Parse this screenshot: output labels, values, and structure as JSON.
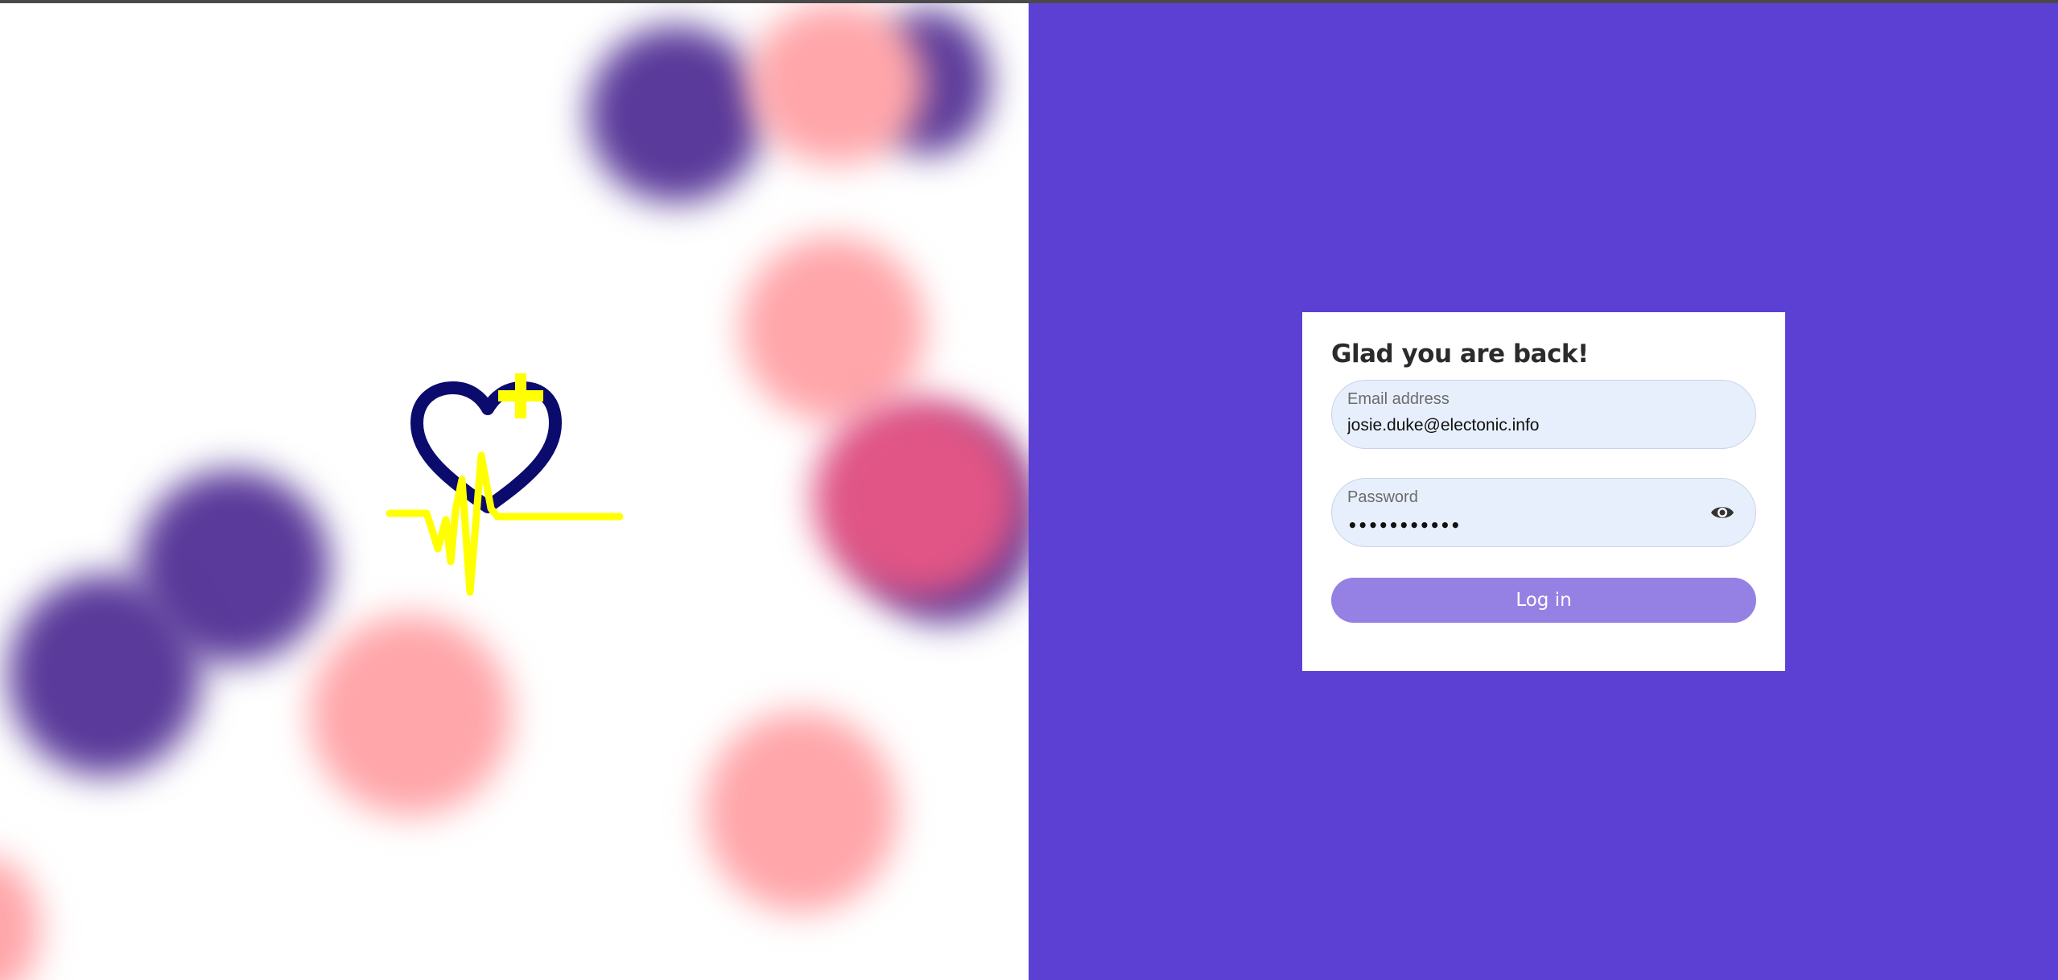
{
  "login": {
    "title": "Glad you are back!",
    "email_label": "Email address",
    "email_value": "josie.duke@electonic.info",
    "password_label": "Password",
    "password_masked": "•••••••••••",
    "login_label": "Log in",
    "show_password_icon": "eye-icon"
  },
  "colors": {
    "brand_panel": "#5c40d4",
    "button": "#9581e3",
    "input_bg": "#e8effc",
    "logo_heart": "#0b0b6e",
    "logo_pulse": "#ffff00"
  },
  "logo": {
    "icon": "heart-pulse-plus-logo"
  }
}
